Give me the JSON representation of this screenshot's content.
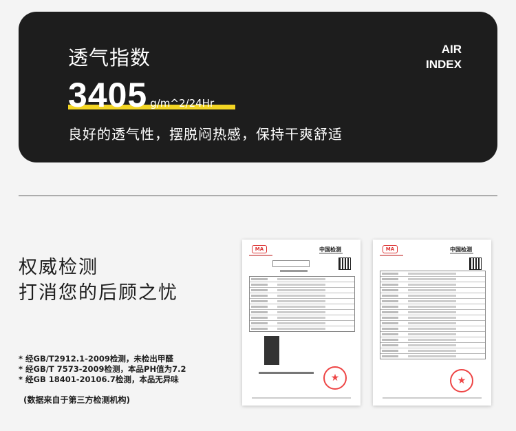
{
  "header": {
    "title": "透气指数",
    "air_line1": "AIR",
    "air_line2": "INDEX",
    "value": "3405",
    "unit": "g/m^2/24Hr",
    "subtitle": "良好的透气性，摆脱闷热感，保持干爽舒适"
  },
  "authority": {
    "heading_line1": "权威检测",
    "heading_line2": "打消您的后顾之忧",
    "notes": [
      "* 经GB/T2912.1-2009检测，未检出甲醛",
      "* 经GB/T 7573-2009检测，本品PH值为7.2",
      "* 经GB 18401-20106.7检测，本品无异味"
    ],
    "source": "(数据来自于第三方检测机构)"
  },
  "documents": [
    {
      "logo": "MA",
      "header": "中国检测"
    },
    {
      "logo": "MA",
      "header": "中国检测"
    }
  ],
  "colors": {
    "card_bg": "#1d1d1d",
    "accent": "#f3d523",
    "seal": "#e44"
  },
  "icons": {
    "seal": "star-icon",
    "qr": "qr-code-icon"
  }
}
